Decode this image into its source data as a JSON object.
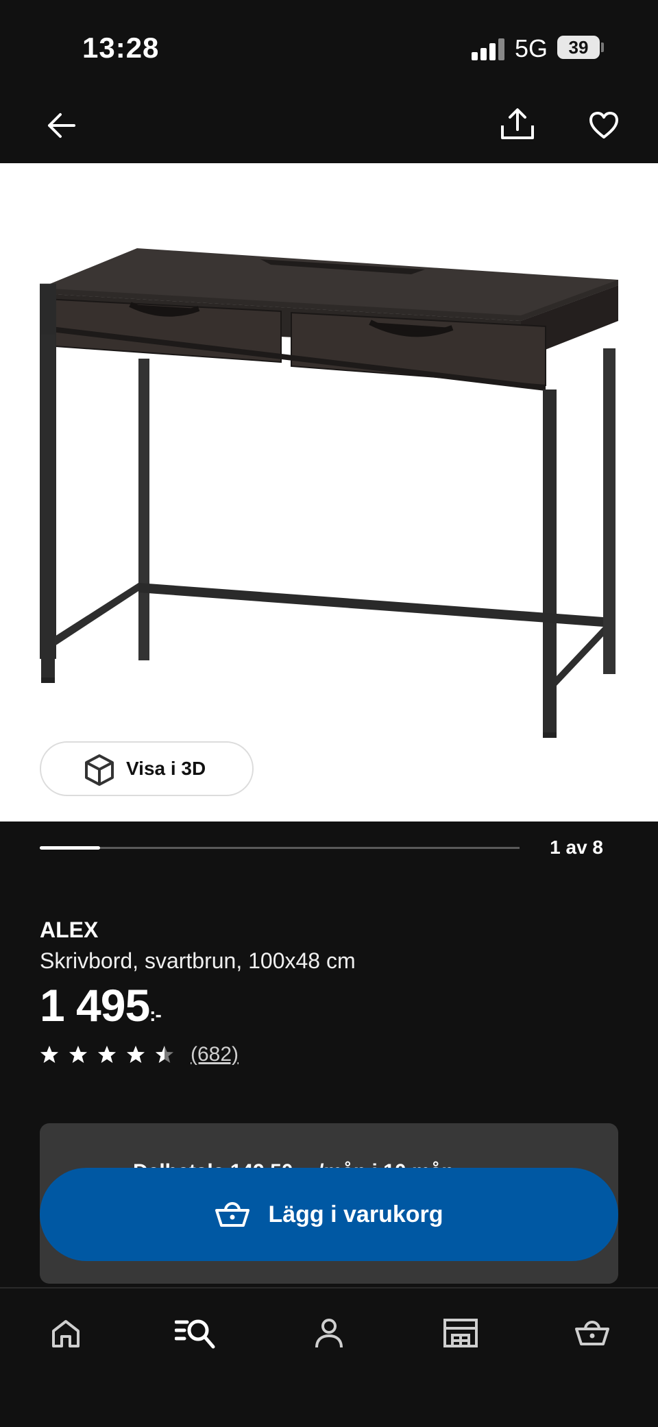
{
  "status_bar": {
    "time": "13:28",
    "network": "5G",
    "battery": "39"
  },
  "header": {
    "back_icon": "arrow-left-icon",
    "share_icon": "share-icon",
    "favorite_icon": "heart-icon"
  },
  "gallery": {
    "image_alt": "ALEX desk, black-brown",
    "view_3d_label": "Visa i 3D",
    "current_page": 1,
    "total_pages": 8,
    "page_label": "1 av 8"
  },
  "product": {
    "name": "ALEX",
    "description": "Skrivbord, svartbrun, 100x48 cm",
    "price": "1 495",
    "price_suffix": ":-",
    "rating": 4.5,
    "rating_max": 5,
    "review_count": "(682)"
  },
  "installment": {
    "text": "Delbetala 149,50 :- /mån i 10 mån"
  },
  "cta": {
    "label": "Lägg i varukorg",
    "icon": "basket-icon",
    "color": "#0058a3"
  },
  "tabbar": {
    "items": [
      {
        "name": "home",
        "icon": "home-icon"
      },
      {
        "name": "search",
        "icon": "search-list-icon",
        "active": true
      },
      {
        "name": "profile",
        "icon": "person-icon"
      },
      {
        "name": "stores",
        "icon": "store-icon"
      },
      {
        "name": "cart",
        "icon": "basket-icon"
      }
    ]
  },
  "colors": {
    "background": "#111111",
    "accent": "#0058a3",
    "card": "#383838"
  }
}
